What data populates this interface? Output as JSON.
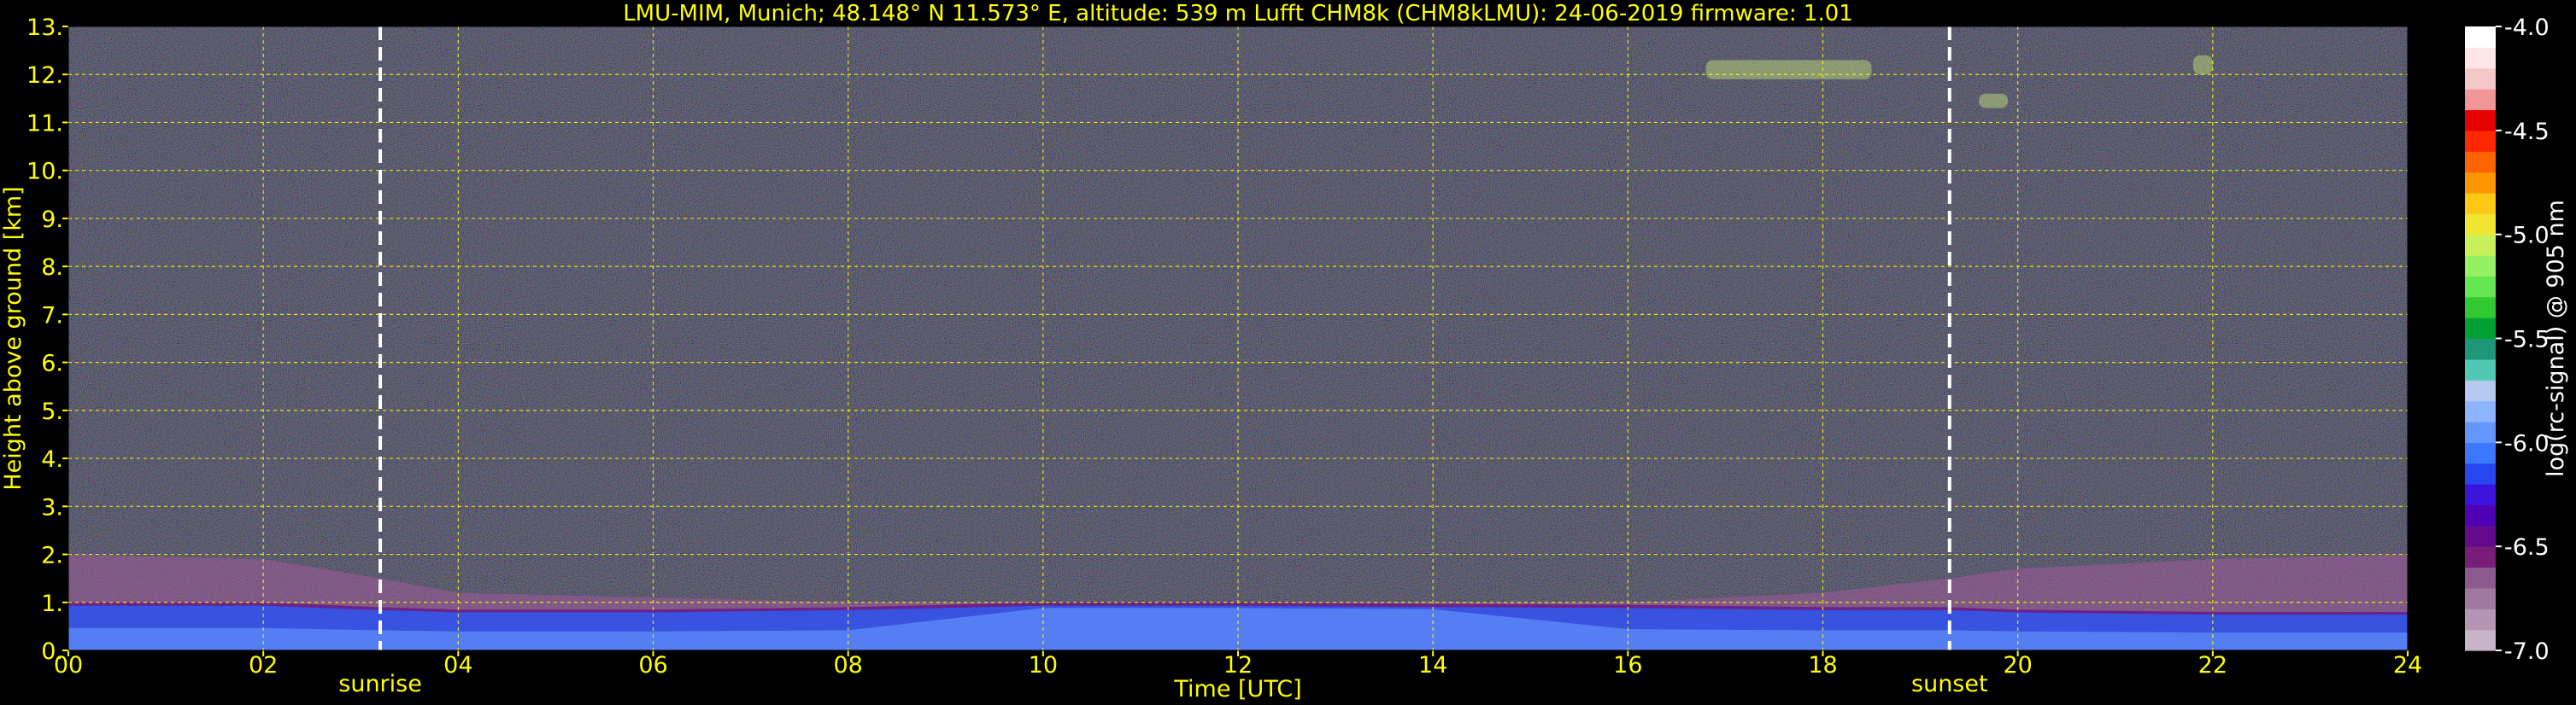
{
  "title": "LMU-MIM, Munich; 48.148° N 11.573° E, altitude: 539 m    Lufft CHM8k (CHM8kLMU): 24-06-2019    firmware: 1.01",
  "colors": {
    "background": "#000000",
    "text": "#ffff00",
    "grid": "#ffff00",
    "event_line": "#ffffff",
    "colorbar_text": "#ffffff"
  },
  "chart_data": {
    "type": "heatmap",
    "title": "LMU-MIM, Munich; 48.148° N 11.573° E, altitude: 539 m    Lufft CHM8k (CHM8kLMU): 24-06-2019    firmware: 1.01",
    "xlabel": "Time [UTC]",
    "ylabel": "Height above ground [km]",
    "xlim": [
      0,
      24
    ],
    "ylim": [
      0,
      13
    ],
    "xticks": [
      0,
      2,
      4,
      6,
      8,
      10,
      12,
      14,
      16,
      18,
      20,
      22,
      24
    ],
    "xtick_labels": [
      "00",
      "02",
      "04",
      "06",
      "08",
      "10",
      "12",
      "14",
      "16",
      "18",
      "20",
      "22",
      "24"
    ],
    "yticks": [
      0,
      1,
      2,
      3,
      4,
      5,
      6,
      7,
      8,
      9,
      10,
      11,
      12,
      13
    ],
    "ytick_labels": [
      "0.",
      "1.",
      "2.",
      "3.",
      "4.",
      "5.",
      "6.",
      "7.",
      "8.",
      "9.",
      "10.",
      "11.",
      "12.",
      "13."
    ],
    "grid": true,
    "events": [
      {
        "label": "sunrise",
        "time": 3.2
      },
      {
        "label": "sunset",
        "time": 19.3
      }
    ],
    "colorbar": {
      "label": "log(rc-signal) @ 905 nm",
      "range": [
        -7.0,
        -4.0
      ],
      "ticks": [
        -7.0,
        -6.5,
        -6.0,
        -5.5,
        -5.0,
        -4.5,
        -4.0
      ],
      "tick_labels": [
        "-7.0",
        "-6.5",
        "-6.0",
        "-5.5",
        "-5.0",
        "-4.5",
        "-4.0"
      ],
      "colors": [
        "#c8b4c8",
        "#b496b4",
        "#a078a0",
        "#8c5a8c",
        "#781e78",
        "#640a8c",
        "#5000b4",
        "#3c14dc",
        "#2846f0",
        "#3c78ff",
        "#6496ff",
        "#8cb4ff",
        "#b4c8f0",
        "#50c8b4",
        "#1e9678",
        "#00a032",
        "#32c832",
        "#64e650",
        "#96f064",
        "#c8f05a",
        "#f0e632",
        "#ffc814",
        "#ff9600",
        "#ff6400",
        "#ff2800",
        "#e60000",
        "#f09696",
        "#f5c8c8",
        "#ffe6e6",
        "#ffffff"
      ]
    },
    "profile": {
      "boundary_layer_top_km": [
        [
          0,
          1.0
        ],
        [
          2,
          1.0
        ],
        [
          3.2,
          0.9
        ],
        [
          4,
          0.85
        ],
        [
          6,
          0.85
        ],
        [
          8,
          0.9
        ],
        [
          10,
          1.0
        ],
        [
          12,
          1.0
        ],
        [
          14,
          0.97
        ],
        [
          16,
          0.95
        ],
        [
          18,
          0.9
        ],
        [
          19.3,
          0.9
        ],
        [
          20,
          0.85
        ],
        [
          22,
          0.8
        ],
        [
          24,
          0.8
        ]
      ],
      "aerosol_layer_top_km": [
        [
          0,
          2.0
        ],
        [
          2,
          1.9
        ],
        [
          3.2,
          1.5
        ],
        [
          4,
          1.2
        ],
        [
          6,
          1.1
        ],
        [
          8,
          1.0
        ],
        [
          12,
          1.0
        ],
        [
          16,
          1.0
        ],
        [
          18,
          1.2
        ],
        [
          19.3,
          1.5
        ],
        [
          20,
          1.7
        ],
        [
          22,
          1.9
        ],
        [
          24,
          2.0
        ]
      ]
    },
    "cloud_features": [
      {
        "time_start": 16.8,
        "time_end": 18.5,
        "base_km": 11.9,
        "top_km": 12.3
      },
      {
        "time_start": 19.6,
        "time_end": 19.9,
        "base_km": 11.3,
        "top_km": 11.6
      },
      {
        "time_start": 21.8,
        "time_end": 22.0,
        "base_km": 12.0,
        "top_km": 12.4
      }
    ]
  }
}
